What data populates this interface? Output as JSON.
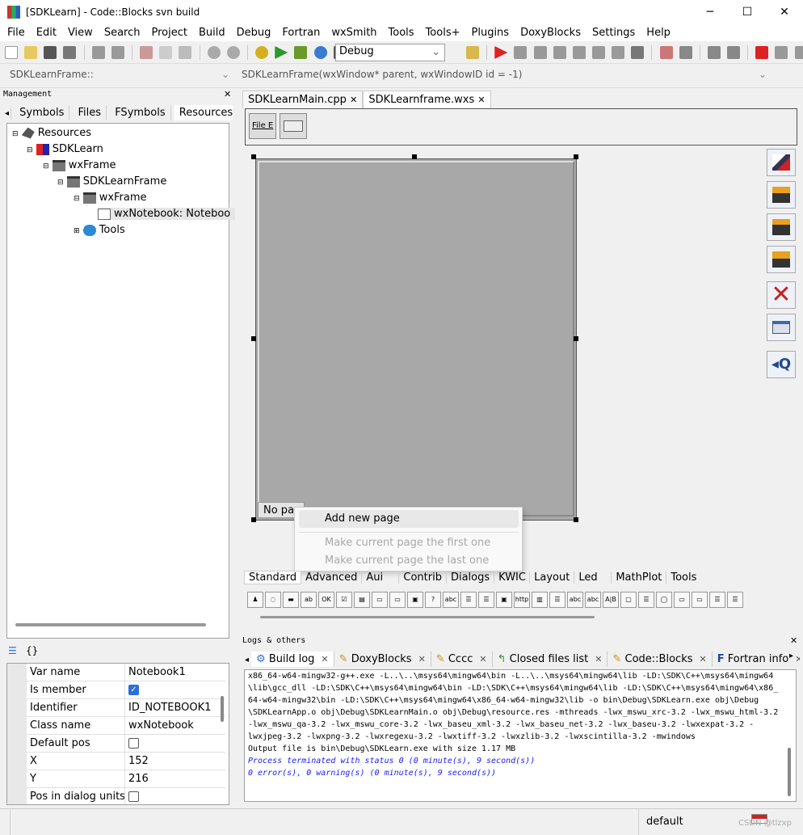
{
  "window": {
    "title": "[SDKLearn] - Code::Blocks svn build",
    "minimize": "─",
    "maximize": "☐",
    "close": "✕"
  },
  "menu": [
    "File",
    "Edit",
    "View",
    "Search",
    "Project",
    "Build",
    "Debug",
    "Fortran",
    "wxSmith",
    "Tools",
    "Tools+",
    "Plugins",
    "DoxyBlocks",
    "Settings",
    "Help"
  ],
  "toolbar": {
    "build_target": "Debug"
  },
  "codebar": {
    "scope": "SDKLearnFrame::",
    "function": "SDKLearnFrame(wxWindow* parent, wxWindowID id = -1)"
  },
  "management": {
    "title": "Management",
    "tabs": [
      "Symbols",
      "Files",
      "FSymbols",
      "Resources"
    ],
    "tree": [
      {
        "label": "Resources",
        "icon": "resources-icon"
      },
      {
        "label": "SDKLearn",
        "icon": "project-icon"
      },
      {
        "label": "wxFrame",
        "icon": "frame-icon"
      },
      {
        "label": "SDKLearnFrame",
        "icon": "frame-icon"
      },
      {
        "label": "wxFrame",
        "icon": "frame-icon"
      },
      {
        "label": "wxNotebook: Noteboo",
        "icon": "notebook-icon"
      },
      {
        "label": "Tools",
        "icon": "tools-icon"
      }
    ]
  },
  "properties": {
    "tab_icons": [
      "☰",
      "{}"
    ],
    "rows": [
      {
        "key": "Var name",
        "value": "Notebook1"
      },
      {
        "key": "Is member",
        "value": "✓"
      },
      {
        "key": "Identifier",
        "value": "ID_NOTEBOOK1"
      },
      {
        "key": "Class name",
        "value": "wxNotebook"
      },
      {
        "key": "Default pos",
        "value": ""
      },
      {
        "key": "X",
        "value": "152"
      },
      {
        "key": "Y",
        "value": "216"
      },
      {
        "key": "Pos in dialog units",
        "value": ""
      }
    ]
  },
  "editor": {
    "tabs": [
      "SDKLearnMain.cpp",
      "SDKLearnframe.wxs"
    ],
    "close": "✕",
    "menu_preview": "File E",
    "notebook_tab": "No pag"
  },
  "context_menu": {
    "items": [
      {
        "label": "Add new page",
        "enabled": true
      },
      {
        "label": "Make current page the first one",
        "enabled": false
      },
      {
        "label": "Make current page the last one",
        "enabled": false
      }
    ]
  },
  "palette": {
    "tabs": [
      "Standard",
      "Advanced",
      "Aui",
      "Contrib",
      "Dialogs",
      "KWIC",
      "Layout",
      "Led",
      "MathPlot",
      "Tools"
    ],
    "icons": [
      "♟",
      "◌",
      "▬",
      "ab",
      "OK",
      "☑",
      "▤",
      "▭",
      "▭",
      "▣",
      "?",
      "abc",
      "☰",
      "☰",
      "▣",
      "http",
      "▥",
      "☰",
      "abc",
      "abc",
      "A|B",
      "▢",
      "☰",
      "◯",
      "▭",
      "▭",
      "☰",
      "☰"
    ]
  },
  "logs": {
    "title": "Logs & others",
    "tabs": [
      "Build log",
      "DoxyBlocks",
      "Cccc",
      "Closed files list",
      "Code::Blocks",
      "Fortran info"
    ],
    "lines": [
      {
        "text": "x86_64-w64-mingw32-g++.exe -L..\\..\\msys64\\mingw64\\bin -L..\\..\\msys64\\mingw64\\lib -LD:\\SDK\\C++\\msys64\\mingw64",
        "color": "black"
      },
      {
        "text": "\\lib\\gcc_dll -LD:\\SDK\\C++\\msys64\\mingw64\\bin -LD:\\SDK\\C++\\msys64\\mingw64\\lib -LD:\\SDK\\C++\\msys64\\mingw64\\x86_",
        "color": "black"
      },
      {
        "text": "64-w64-mingw32\\bin -LD:\\SDK\\C++\\msys64\\mingw64\\x86_64-w64-mingw32\\lib -o bin\\Debug\\SDKLearn.exe  obj\\Debug",
        "color": "black"
      },
      {
        "text": "\\SDKLearnApp.o obj\\Debug\\SDKLearnMain.o obj\\Debug\\resource.res -mthreads -lwx_mswu_xrc-3.2 -lwx_mswu_html-3.2",
        "color": "black"
      },
      {
        "text": "-lwx_mswu_qa-3.2 -lwx_mswu_core-3.2 -lwx_baseu_xml-3.2 -lwx_baseu_net-3.2 -lwx_baseu-3.2 -lwxexpat-3.2 -",
        "color": "black"
      },
      {
        "text": "lwxjpeg-3.2 -lwxpng-3.2 -lwxregexu-3.2 -lwxtiff-3.2 -lwxzlib-3.2 -lwxscintilla-3.2   -mwindows",
        "color": "black"
      },
      {
        "text": "Output file is bin\\Debug\\SDKLearn.exe with size 1.17 MB",
        "color": "black"
      },
      {
        "text": "Process terminated with status 0 (0 minute(s), 9 second(s))",
        "color": "blue"
      },
      {
        "text": "0 error(s), 0 warning(s) (0 minute(s), 9 second(s))",
        "color": "blue"
      }
    ]
  },
  "statusbar": {
    "text": "default",
    "watermark": "CSDN @tlzxp"
  }
}
